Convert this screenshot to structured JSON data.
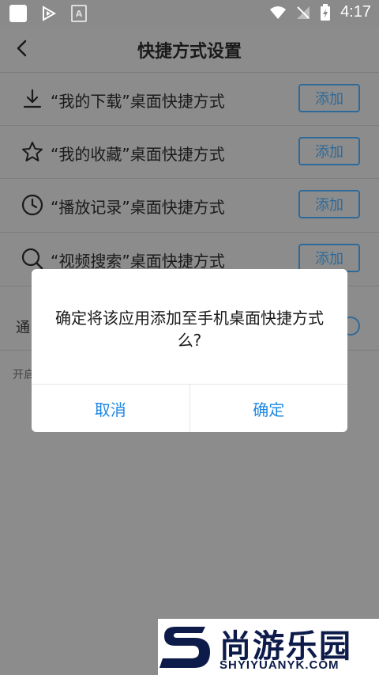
{
  "statusbar": {
    "time": "4:17"
  },
  "header": {
    "title": "快捷方式设置"
  },
  "shortcuts": [
    {
      "icon": "download-icon",
      "label": "“我的下载”桌面快捷方式",
      "button": "添加"
    },
    {
      "icon": "star-icon",
      "label": "“我的收藏”桌面快捷方式",
      "button": "添加"
    },
    {
      "icon": "clock-icon",
      "label": "“播放记录”桌面快捷方式",
      "button": "添加"
    },
    {
      "icon": "search-icon",
      "label": "“视频搜索”桌面快捷方式",
      "button": "添加"
    }
  ],
  "notify": {
    "label": "通",
    "hint": "开启"
  },
  "dialog": {
    "message": "确定将该应用添加至手机桌面快捷方式么?",
    "cancel": "取消",
    "confirm": "确定"
  },
  "watermark": {
    "cn": "尚游乐园",
    "en": "SHYIYUANYK.COM"
  },
  "colors": {
    "accent": "#1e88e5",
    "button_border": "#2e6a99",
    "overlay": "#8c8c8c"
  }
}
